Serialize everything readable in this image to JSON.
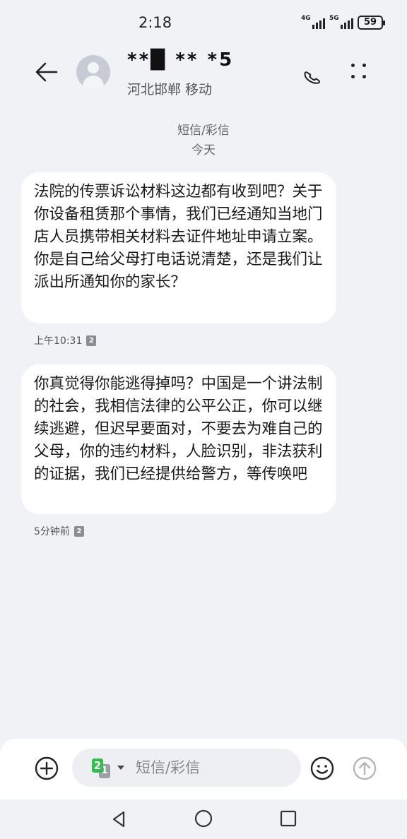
{
  "status_bar": {
    "time": "2:18",
    "network_1": "4G",
    "network_2": "5G",
    "battery": "59"
  },
  "header": {
    "contact_name": "**█ ** *5",
    "contact_location": "河北邯郸 移动",
    "icons": {
      "back": "back-arrow-icon",
      "call": "phone-icon",
      "more": "more-vertical-icon",
      "avatar": "contact-avatar-icon"
    }
  },
  "conversation": {
    "message_type": "短信/彩信",
    "day": "今天",
    "messages": [
      {
        "text": "法院的传票诉讼材料这边都有收到吧？关于你设备租赁那个事情，我们已经通知当地门店人员携带相关材料去证件地址申请立案。你是自己给父母打电话说清楚，还是我们让派出所通知你的家长？",
        "time": "上午10:31",
        "sim": "2"
      },
      {
        "text": "你真觉得你能逃得掉吗？中国是一个讲法制的社会，我相信法律的公平公正，你可以继续逃避，但迟早要面对，不要去为难自己的父母，你的违约材料，人脸识别，非法获利的证据，我们已经提供给警方，等传唤吧",
        "time": "5分钟前",
        "sim": "2"
      }
    ]
  },
  "composer": {
    "placeholder": "短信/彩信",
    "sim_primary": "2",
    "sim_secondary": "1",
    "colors": {
      "sim_active": "#2fbf4e",
      "sim_inactive": "#9aa0a6"
    },
    "icons": {
      "add": "add-circle-icon",
      "emoji": "emoji-icon",
      "send": "send-icon"
    }
  },
  "nav_bar": {
    "icons": {
      "back": "nav-back-icon",
      "home": "nav-home-icon",
      "recents": "nav-recents-icon"
    }
  }
}
